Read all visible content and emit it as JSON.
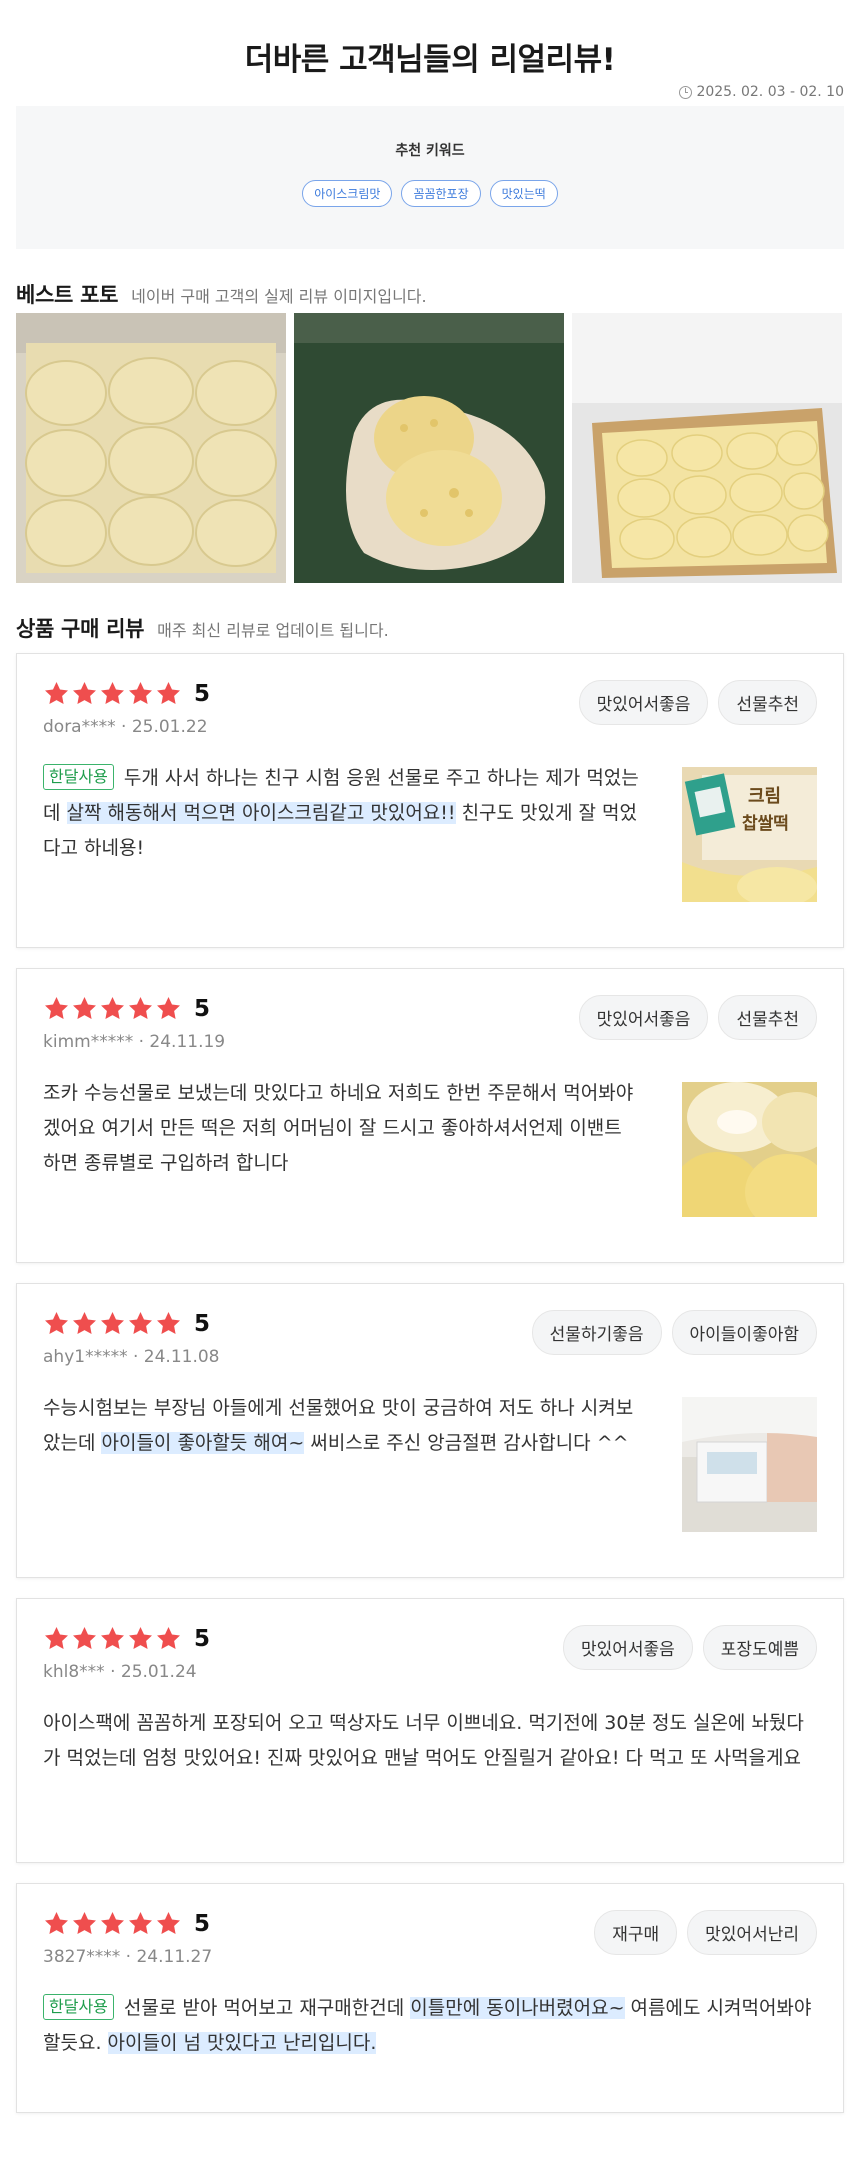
{
  "header": {
    "title": "더바른 고객님들의 리얼리뷰!",
    "date_range": "2025. 02. 03 - 02. 10"
  },
  "keywords": {
    "title": "추천 키워드",
    "chips": [
      "아이스크림맛",
      "꼼꼼한포장",
      "맛있는떡"
    ]
  },
  "best_photo": {
    "title": "베스트 포토",
    "subtitle": "네이버 구매 고객의 실제 리뷰 이미지입니다."
  },
  "purchase_reviews": {
    "title": "상품 구매 리뷰",
    "subtitle": "매주 최신 리뷰로 업데이트 됩니다."
  },
  "colors": {
    "star": "#ef4e4e",
    "keyword_chip": "#3d7bdc",
    "badge": "#1f9d4c",
    "highlight": "#dcecff"
  },
  "reviews": [
    {
      "rating": "5",
      "user": "dora****",
      "date": "25.01.22",
      "tags": [
        "맛있어서좋음",
        "선물추천"
      ],
      "badge": "한달사용",
      "text_a": "두개 사서 하나는 친구 시험 응원 선물로 주고 하나는 제가 먹었는데 ",
      "highlight_a": "살짝 해동해서 먹으면 아이스크림같고 맛있어요!!",
      "text_b": " 친구도 맛있게 잘 먹었다고 하네용!",
      "highlight_b": "",
      "text_c": "",
      "thumb_text": "크림 찹쌀떡"
    },
    {
      "rating": "5",
      "user": "kimm*****",
      "date": "24.11.19",
      "tags": [
        "맛있어서좋음",
        "선물추천"
      ],
      "badge": "",
      "text_a": "조카 수능선물로 보냈는데 맛있다고 하네요 저희도 한번 주문해서 먹어봐야겠어요 여기서 만든 떡은 저희 어머님이 잘 드시고 좋아하셔서언제 이밴트 하면 종류별로 구입하려 합니다",
      "highlight_a": "",
      "text_b": "",
      "highlight_b": "",
      "text_c": ""
    },
    {
      "rating": "5",
      "user": "ahy1*****",
      "date": "24.11.08",
      "tags": [
        "선물하기좋음",
        "아이들이좋아함"
      ],
      "badge": "",
      "text_a": "수능시험보는 부장님 아들에게 선물했어요 맛이 궁금하여 저도 하나 시켜보았는데 ",
      "highlight_a": "아이들이 좋아할듯 해여~",
      "text_b": " 써비스로 주신 앙금절편 감사합니다 ^^",
      "highlight_b": "",
      "text_c": ""
    },
    {
      "rating": "5",
      "user": "khl8***",
      "date": "25.01.24",
      "tags": [
        "맛있어서좋음",
        "포장도예쁨"
      ],
      "badge": "",
      "text_a": "아이스팩에 꼼꼼하게 포장되어 오고 떡상자도 너무 이쁘네요. 먹기전에 30분 정도 실온에 놔뒀다가 먹었는데 엄청 맛있어요! 진짜 맛있어요 맨날 먹어도 안질릴거 같아요! 다 먹고 또 사먹을게요",
      "highlight_a": "",
      "text_b": "",
      "highlight_b": "",
      "text_c": ""
    },
    {
      "rating": "5",
      "user": "3827****",
      "date": "24.11.27",
      "tags": [
        "재구매",
        "맛있어서난리"
      ],
      "badge": "한달사용",
      "text_a": "선물로 받아 먹어보고 재구매한건데 ",
      "highlight_a": "이틀만에 동이나버렸어요~",
      "text_b": " 여름에도 시켜먹어봐야할듯요. ",
      "highlight_b": "아이들이 넘 맛있다고 난리입니다.",
      "text_c": ""
    }
  ]
}
